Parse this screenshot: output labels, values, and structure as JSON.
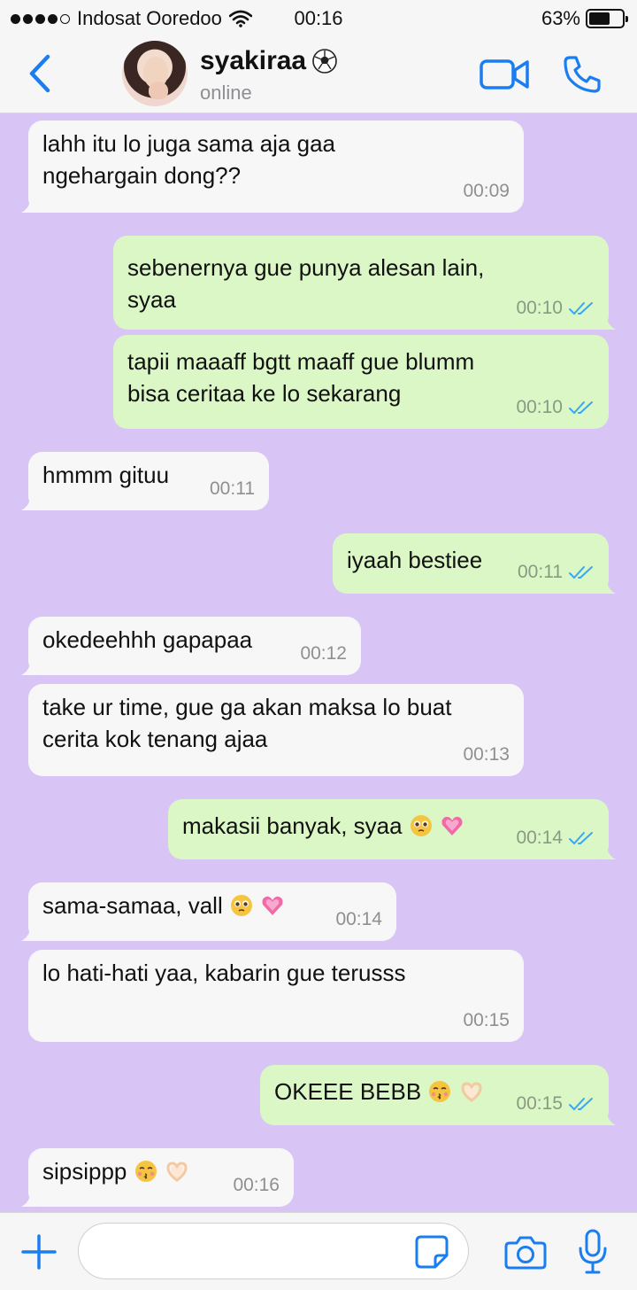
{
  "status_bar": {
    "carrier": "Indosat Ooredoo",
    "time": "00:16",
    "battery_percent": "63%",
    "battery_level": 0.63,
    "signal_bars_filled": 4
  },
  "header": {
    "contact_name": "syakiraa",
    "presence": "online"
  },
  "messages": [
    {
      "dir": "in",
      "lines": [
        "lahh itu lo juga sama aja gaa",
        "ngehargain dong??"
      ],
      "time": "00:09"
    },
    {
      "dir": "out",
      "lines": [
        "sebenernya gue punya alesan lain,",
        "syaa"
      ],
      "time": "00:10"
    },
    {
      "dir": "out",
      "lines": [
        "tapii maaaff bgtt maaff gue blumm",
        "bisa ceritaa ke lo sekarang"
      ],
      "time": "00:10"
    },
    {
      "dir": "in",
      "lines": [
        "hmmm gituu"
      ],
      "time": "00:11"
    },
    {
      "dir": "out",
      "lines": [
        "iyaah bestiee"
      ],
      "time": "00:11"
    },
    {
      "dir": "in",
      "lines": [
        "okedeehhh gapapaa"
      ],
      "time": "00:12"
    },
    {
      "dir": "in",
      "lines": [
        "take ur time, gue ga akan maksa lo buat",
        "cerita kok tenang ajaa"
      ],
      "time": "00:13"
    },
    {
      "dir": "out",
      "lines": [
        "makasii banyak, syaa"
      ],
      "emojis": [
        "pleading-face",
        "growing-heart"
      ],
      "time": "00:14"
    },
    {
      "dir": "in",
      "lines": [
        "sama-samaa, vall"
      ],
      "emojis": [
        "pleading-face",
        "growing-heart"
      ],
      "time": "00:14"
    },
    {
      "dir": "in",
      "lines": [
        "lo hati-hati yaa, kabarin gue terusss"
      ],
      "time": "00:15"
    },
    {
      "dir": "out",
      "lines": [
        "OKEEE BEBB"
      ],
      "emojis": [
        "kissing-face",
        "heart-hands"
      ],
      "time": "00:15"
    },
    {
      "dir": "in",
      "lines": [
        "sipsippp"
      ],
      "emojis": [
        "kissing-face",
        "heart-hands"
      ],
      "time": "00:16"
    }
  ],
  "composer": {
    "placeholder": ""
  },
  "colors": {
    "accent": "#1a7ef1",
    "chat_background": "#d8c5f6",
    "incoming_bubble": "#f7f7f7",
    "outgoing_bubble": "#dbf7c6",
    "read_ticks": "#3aa7f2"
  },
  "icons": [
    "back-chevron-icon",
    "soccer-ball-icon",
    "video-call-icon",
    "phone-icon",
    "plus-icon",
    "sticker-icon",
    "camera-icon",
    "microphone-icon",
    "double-check-icon",
    "wifi-icon",
    "battery-icon"
  ]
}
